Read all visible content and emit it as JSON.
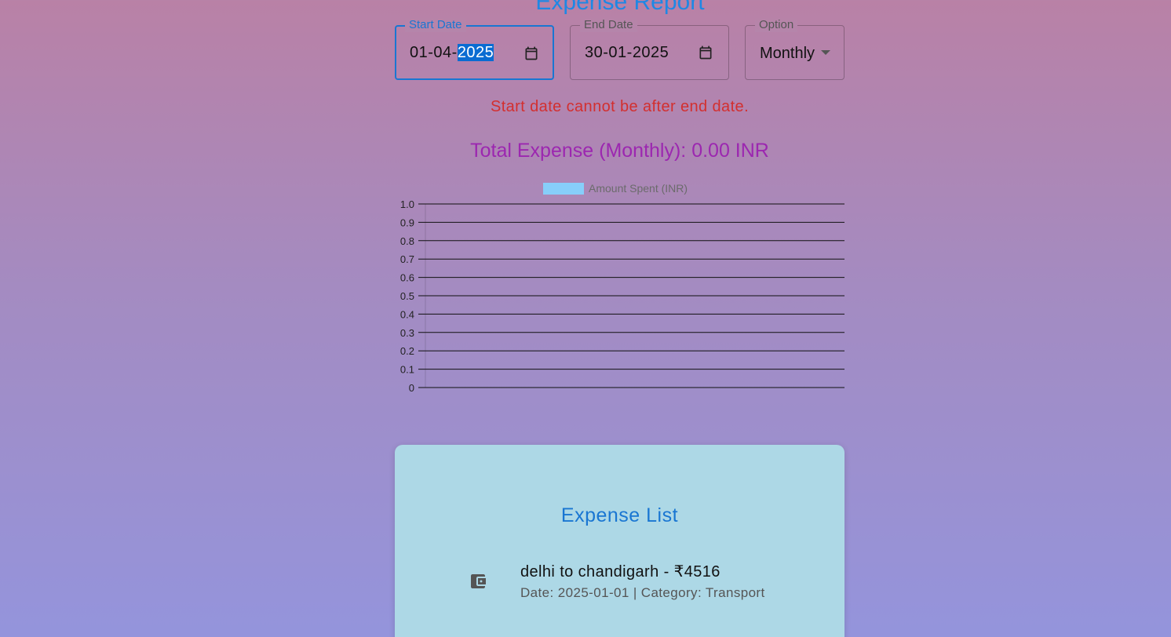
{
  "page": {
    "title": "Expense Report"
  },
  "filters": {
    "start_date": {
      "label": "Start Date",
      "value_prefix": "01-04-",
      "value_selected": "2025"
    },
    "end_date": {
      "label": "End Date",
      "value": "30-01-2025"
    },
    "option": {
      "label": "Option",
      "value": "Monthly"
    }
  },
  "error_message": "Start date cannot be after end date.",
  "total_expense": "Total Expense (Monthly): 0.00 INR",
  "chart_data": {
    "type": "bar",
    "categories": [],
    "series": [
      {
        "name": "Amount Spent (INR)",
        "values": []
      }
    ],
    "legend_color": "#87cefa",
    "yticks": [
      "0",
      "0.1",
      "0.2",
      "0.3",
      "0.4",
      "0.5",
      "0.6",
      "0.7",
      "0.8",
      "0.9",
      "1.0"
    ],
    "ylim": [
      0,
      1
    ],
    "grid": true,
    "legend_position": "top"
  },
  "expense_list": {
    "title": "Expense List",
    "items": [
      {
        "icon": "wallet-icon",
        "primary": "delhi to chandigarh - ₹4516",
        "secondary": "Date: 2025-01-01 | Category: Transport"
      }
    ]
  },
  "colors": {
    "accent": "#1976d2",
    "error": "#d32f2f",
    "total": "#9c27b0",
    "card": "#add8e6"
  }
}
